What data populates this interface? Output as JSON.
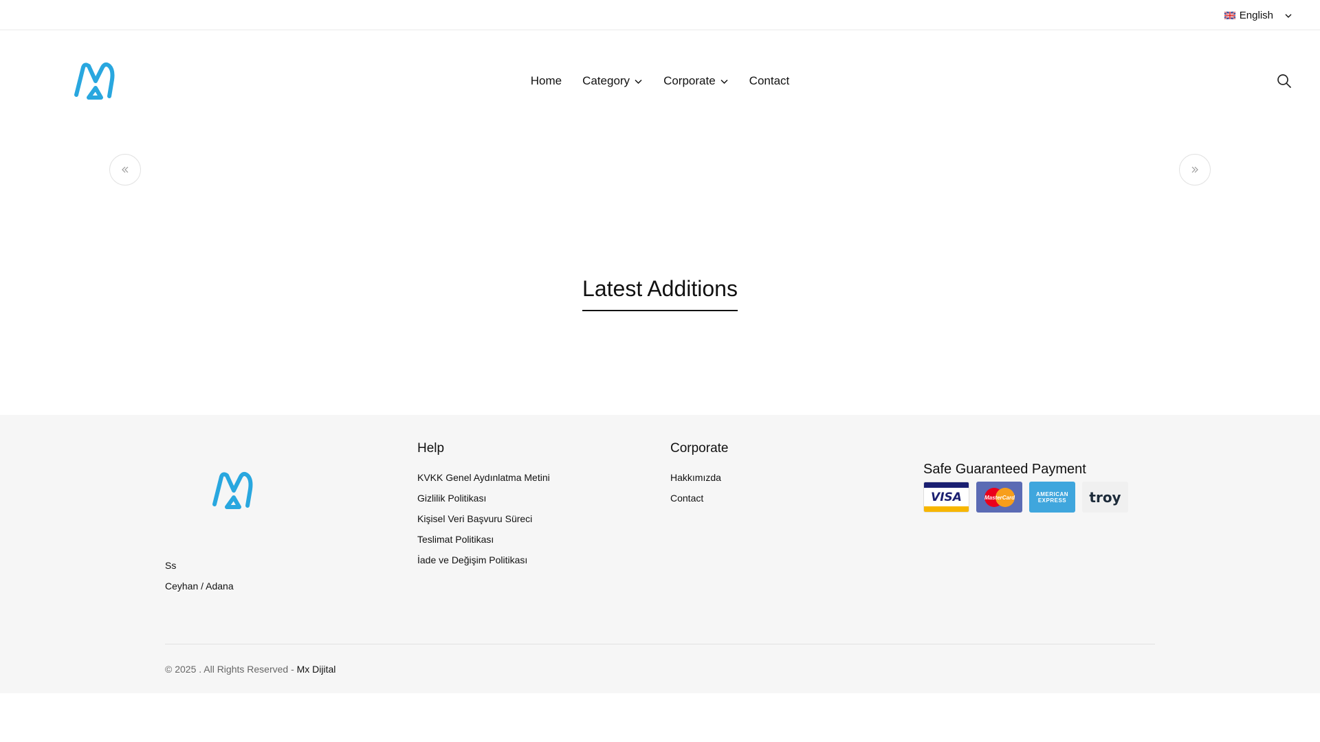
{
  "topbar": {
    "language": {
      "label": "English",
      "flag_icon": "uk-flag-icon"
    }
  },
  "header": {
    "nav": [
      {
        "label": "Home",
        "dropdown": false
      },
      {
        "label": "Category",
        "dropdown": true
      },
      {
        "label": "Corporate",
        "dropdown": true
      },
      {
        "label": "Contact",
        "dropdown": false
      }
    ]
  },
  "main": {
    "section_title": "Latest Additions"
  },
  "footer": {
    "address": [
      "Ss",
      "Ceyhan / Adana"
    ],
    "help": {
      "title": "Help",
      "links": [
        "KVKK Genel Aydınlatma Metini",
        "Gizlilik Politikası",
        "Kişisel Veri Başvuru Süreci",
        "Teslimat Politikası",
        "İade ve Değişim Politikası"
      ]
    },
    "corporate": {
      "title": "Corporate",
      "links": [
        "Hakkımızda",
        "Contact"
      ]
    },
    "payment": {
      "title": "Safe Guaranteed Payment",
      "cards": {
        "visa": "VISA",
        "mastercard": "MasterCard",
        "amex_line1": "AMERICAN",
        "amex_line2": "EXPRESS",
        "troy": "troy"
      }
    },
    "copyright": {
      "text": "© 2025 . All Rights Reserved - ",
      "link": "Mx Dijital"
    }
  },
  "colors": {
    "logo": "#29a7df",
    "footer_bg": "#f6f6f6",
    "text": "#111111"
  }
}
